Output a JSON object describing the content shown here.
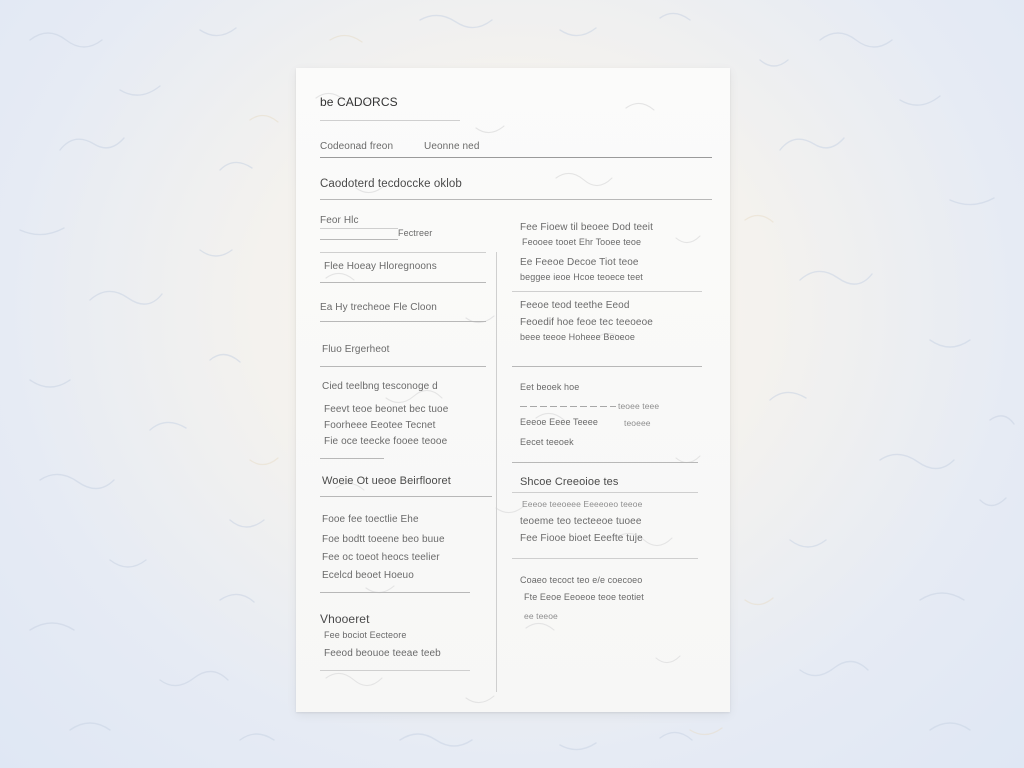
{
  "document": {
    "title": "be CADORCS",
    "subtitle_left": "Codeonad freon",
    "subtitle_right": "Ueonne ned",
    "section_heading": "Caodoterd tecdoccke oklob",
    "left_column": {
      "block1": {
        "label": "Feor Hlc",
        "field_value": "Fectreer",
        "heading": "Flee Hoeay Hloregnoons"
      },
      "block2": {
        "line": "Ea Hy trecheoe Fle Cloon"
      },
      "block3": {
        "line": "Fluo Ergerheot"
      },
      "block4": {
        "heading": "Cied teelbng tesconoge d",
        "lines": [
          "Feevt teoe beonet bec tuoe",
          "Foorheee Eeotee Tecnet",
          "Fie oce teecke fooee teooe"
        ]
      },
      "block5": {
        "heading": "Woeie Ot ueoe Beirflooret"
      },
      "block6": {
        "lines": [
          "Fooe fee toectlie Ehe",
          "Foe bodtt toeene beo buue",
          "Fee oc toeot heocs teelier",
          "Ecelcd beoet Hoeuo"
        ]
      },
      "block7": {
        "heading": "Vhooeret",
        "lines": [
          "Fee bociot    Eecteore",
          "Feeod beouoe teeae teeb"
        ]
      }
    },
    "right_column": {
      "block1": {
        "lines": [
          "Fee Fioew til beoee Dod teeit",
          "Feooee tooet Ehr Tooee teoe",
          "Ee Feeoe Decoe Tiot teoe",
          "beggee ieoe Hcoe teoece teet"
        ]
      },
      "block2": {
        "lines": [
          "Feeoe teod teethe Eeod",
          "Feoedif hoe feoe tec teeoeoe",
          "beee teeoe Hoheee Beoeoe"
        ]
      },
      "block3": {
        "heading": "Eet beoek hoe",
        "field_value": "teoee teee",
        "line_a": "Eeeoe Eeee Teeee",
        "line_a_right": "teoeee",
        "line_b": "Eecet teeoek"
      },
      "block4": {
        "heading": "Shcoe Creeoioe tes",
        "faint_line": "Eeeoe teeoeee Eeeeoeo teeoe",
        "lines": [
          "teoeme teo tecteeoe tuoee",
          "Fee Fiooe bioet Eeefte tuje"
        ]
      },
      "block5": {
        "lines": [
          "Coaeo tecoct teo e/e coecoeo",
          "Fte Eeoe Eeoeoe teoe teotiet"
        ],
        "faint_line": "ee teeoe"
      }
    }
  }
}
